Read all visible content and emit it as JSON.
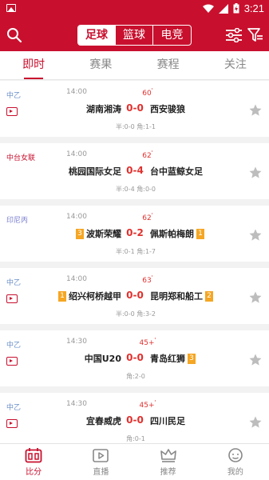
{
  "status_bar": {
    "time": "3:21"
  },
  "header": {
    "sport_tabs": [
      "足球",
      "篮球",
      "电竞"
    ],
    "active_sport": 0
  },
  "subtabs": [
    "即时",
    "赛果",
    "赛程",
    "关注"
  ],
  "active_subtab": 0,
  "matches": [
    {
      "league": "中乙",
      "league_color": "#6b8fc9",
      "time": "14:00",
      "minute": "60",
      "home": "湖南湘涛",
      "home_rank": "",
      "score": "0-0",
      "away": "西安骏狼",
      "away_rank": "",
      "extra": "半:0-0 角:1-1",
      "has_video": true
    },
    {
      "league": "中台女联",
      "league_color": "#c8102e",
      "time": "14:00",
      "minute": "62",
      "home": "桃园国际女足",
      "home_rank": "",
      "score": "0-4",
      "away": "台中蓝鲸女足",
      "away_rank": "",
      "extra": "半:0-4 角:0-0",
      "has_video": false
    },
    {
      "league": "印尼丙",
      "league_color": "#7b7fd0",
      "time": "14:00",
      "minute": "62",
      "home": "波斯荣耀",
      "home_rank": "3",
      "score": "0-2",
      "away": "佩斯帕梅朗",
      "away_rank": "1",
      "extra": "半:0-1 角:1-7",
      "has_video": false
    },
    {
      "league": "中乙",
      "league_color": "#6b8fc9",
      "time": "14:00",
      "minute": "63",
      "home": "绍兴柯桥越甲",
      "home_rank": "1",
      "score": "0-0",
      "away": "昆明郑和船工",
      "away_rank": "2",
      "extra": "半:0-0 角:3-2",
      "has_video": true
    },
    {
      "league": "中乙",
      "league_color": "#6b8fc9",
      "time": "14:30",
      "minute": "45+",
      "home": "中国U20",
      "home_rank": "",
      "score": "0-0",
      "away": "青岛红狮",
      "away_rank": "3",
      "extra": "角:2-0",
      "has_video": true
    },
    {
      "league": "中乙",
      "league_color": "#6b8fc9",
      "time": "14:30",
      "minute": "45+",
      "home": "宜春威虎",
      "home_rank": "",
      "score": "0-0",
      "away": "四川民足",
      "away_rank": "",
      "extra": "角:0-1",
      "has_video": true
    }
  ],
  "bottom_nav": [
    {
      "label": "比分",
      "icon": "scoreboard-icon"
    },
    {
      "label": "直播",
      "icon": "live-tv-icon"
    },
    {
      "label": "推荐",
      "icon": "crown-icon"
    },
    {
      "label": "我的",
      "icon": "profile-face-icon"
    }
  ],
  "active_nav": 0,
  "colors": {
    "brand": "#c8102e",
    "score": "#e0312e",
    "rank_badge": "#f5a623"
  }
}
